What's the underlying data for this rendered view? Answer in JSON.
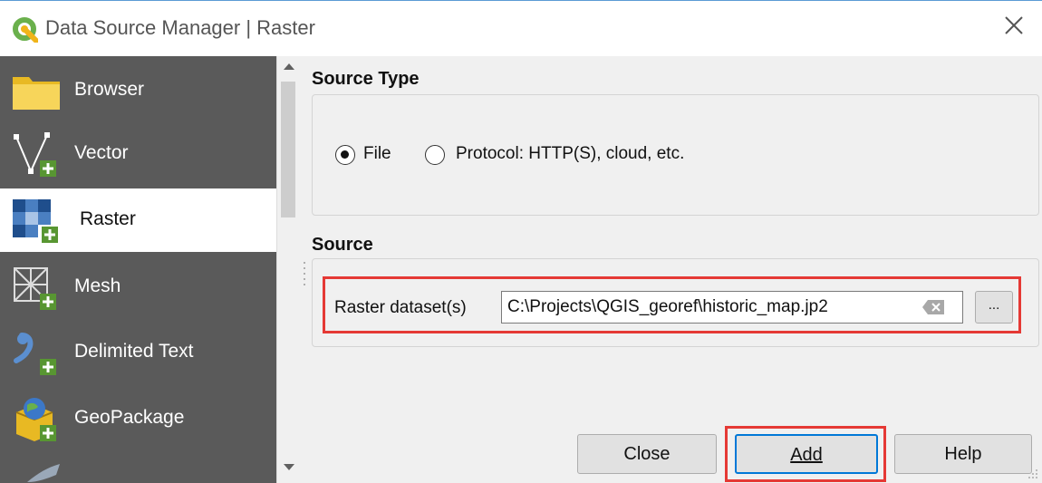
{
  "window": {
    "title": "Data Source Manager | Raster"
  },
  "sidebar": {
    "items": [
      {
        "label": "Browser",
        "icon": "folder-icon",
        "active": false
      },
      {
        "label": "Vector",
        "icon": "vector-add-icon",
        "active": false
      },
      {
        "label": "Raster",
        "icon": "raster-add-icon",
        "active": true
      },
      {
        "label": "Mesh",
        "icon": "mesh-add-icon",
        "active": false
      },
      {
        "label": "Delimited Text",
        "icon": "delimited-text-add-icon",
        "active": false
      },
      {
        "label": "GeoPackage",
        "icon": "geopackage-add-icon",
        "active": false
      }
    ]
  },
  "source_type": {
    "title": "Source Type",
    "options": [
      {
        "label": "File",
        "checked": true
      },
      {
        "label": "Protocol: HTTP(S), cloud, etc.",
        "checked": false
      }
    ]
  },
  "source": {
    "title": "Source",
    "dataset_label": "Raster dataset(s)",
    "dataset_value": "C:\\Projects\\QGIS_georef\\historic_map.jp2",
    "browse_label": "..."
  },
  "buttons": {
    "close": "Close",
    "add": "Add",
    "help": "Help"
  },
  "colors": {
    "highlight": "#e53935",
    "sidebar_bg": "#5a5a5a",
    "qgis_green": "#6ab04c"
  }
}
